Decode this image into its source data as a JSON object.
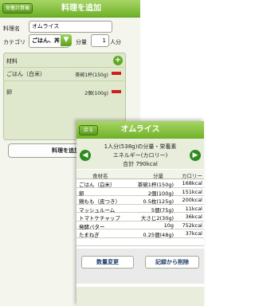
{
  "back": {
    "nav_back_label": "栄養計算機",
    "title": "料理を追加",
    "name_label": "料理名",
    "name_value": "オムライス",
    "category_label": "カテゴリ",
    "category_value": "ごはん、丼",
    "qty_label": "分量",
    "qty_value": "1",
    "qty_unit": "人分",
    "ingredients_label": "材料",
    "ingredients": [
      {
        "name": "ごはん（白米）",
        "amount": "茶碗1杯(150g)"
      },
      {
        "name": "卵",
        "amount": "2個(100g)"
      }
    ],
    "add_button": "料理を追加す"
  },
  "front": {
    "nav_back_label": "戻る",
    "title": "オムライス",
    "line1": "1人分(538g)の分量・栄養素",
    "line2": "エネルギー(カロリー)",
    "line3": "合計 790kcal",
    "columns": [
      "食材名",
      "分量",
      "カロリー"
    ],
    "rows": [
      {
        "name": "ごはん（白米）",
        "amount": "茶碗1杯(150g)",
        "cal": "168kcal"
      },
      {
        "name": "卵",
        "amount": "2個(100g)",
        "cal": "151kcal"
      },
      {
        "name": "鶏もも（皮つき）",
        "amount": "0.5枚(125g)",
        "cal": "200kcal"
      },
      {
        "name": "マッシュルーム",
        "amount": "5個(75g)",
        "cal": "11kcal"
      },
      {
        "name": "トマトケチャップ",
        "amount": "大さじ2(30g)",
        "cal": "36kcal"
      },
      {
        "name": "発酵バター",
        "amount": "10g",
        "cal": "752kcal"
      },
      {
        "name": "たまねぎ",
        "amount": "0.25個(48g)",
        "cal": "37kcal"
      }
    ],
    "btn_change": "数量変更",
    "btn_delete": "記録から削除"
  }
}
